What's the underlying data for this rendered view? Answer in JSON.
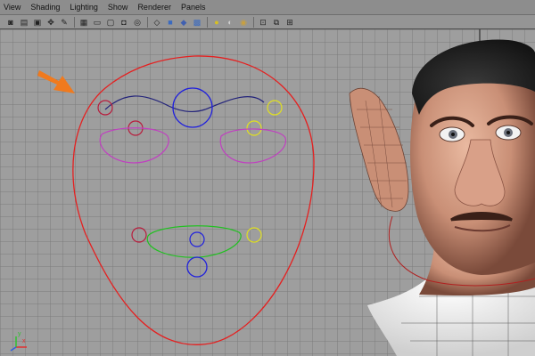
{
  "menubar": {
    "items": [
      "View",
      "Shading",
      "Lighting",
      "Show",
      "Renderer",
      "Panels"
    ]
  },
  "toolbar": {
    "groups": [
      [
        "camera-attributes-icon",
        "bookmark-icon",
        "image-plane-icon",
        "two-d-pan-icon",
        "grease-pencil-icon"
      ],
      [
        "grid-icon",
        "film-gate-icon",
        "resolution-gate-icon",
        "gate-mask-icon",
        "field-chart-icon"
      ],
      [
        "wireframe-icon",
        "smooth-shade-icon",
        "default-material-icon",
        "textured-icon"
      ],
      [
        "use-all-lights-icon",
        "shadows-icon",
        "screen-space-ao-icon"
      ],
      [
        "isolate-select-icon",
        "xray-icon",
        "xray-joints-icon"
      ]
    ]
  },
  "viewport": {
    "axis_label_x": "x",
    "axis_label_y": "y",
    "colors": {
      "grid_background": "#9e9e9e",
      "grid_line": "#7c7c7c",
      "face_outline": "#e52020",
      "brow_curve": "#22227a",
      "cheek_controls": "#c040c0",
      "mouth_controls": "#22c022",
      "center_controls": "#2020dd",
      "right_side_controls": "#e0e020",
      "left_side_controls": "#b81c3c",
      "arrow": "#f07a1e",
      "skin": "#c98f76"
    }
  }
}
